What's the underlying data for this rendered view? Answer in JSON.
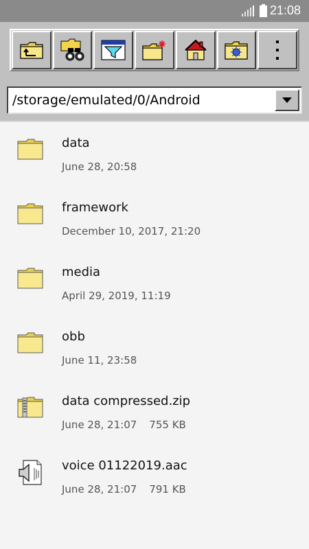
{
  "status_bar": {
    "time": "21:08",
    "signal_icon": "signal-icon",
    "battery_icon": "battery-icon"
  },
  "toolbar": {
    "buttons": [
      {
        "icon": "folder-up-icon"
      },
      {
        "icon": "binoculars-icon"
      },
      {
        "icon": "filter-icon"
      },
      {
        "icon": "new-folder-icon"
      },
      {
        "icon": "home-icon"
      },
      {
        "icon": "folder-settings-icon"
      },
      {
        "icon": "more-vert-icon"
      }
    ]
  },
  "path_bar": {
    "value": "/storage/emulated/0/Android",
    "dropdown_icon": "dropdown-arrow-icon"
  },
  "files": [
    {
      "name": "data",
      "date": "June 28, 20:58",
      "size": "",
      "icon": "folder-icon"
    },
    {
      "name": "framework",
      "date": "December 10, 2017, 21:20",
      "size": "",
      "icon": "folder-icon"
    },
    {
      "name": "media",
      "date": "April 29, 2019, 11:19",
      "size": "",
      "icon": "folder-icon"
    },
    {
      "name": "obb",
      "date": "June 11, 23:58",
      "size": "",
      "icon": "folder-icon"
    },
    {
      "name": "data compressed.zip",
      "date": "June 28, 21:07",
      "size": "755 KB",
      "icon": "zip-folder-icon"
    },
    {
      "name": "voice 01122019.aac",
      "date": "June 28, 21:07",
      "size": "791 KB",
      "icon": "audio-file-icon"
    }
  ],
  "colors": {
    "toolbar_bg": "#c0c0c0",
    "status_bar_bg": "#8a8a8a",
    "list_bg": "#f4f4f4",
    "folder_yellow": "#f6e57a"
  }
}
